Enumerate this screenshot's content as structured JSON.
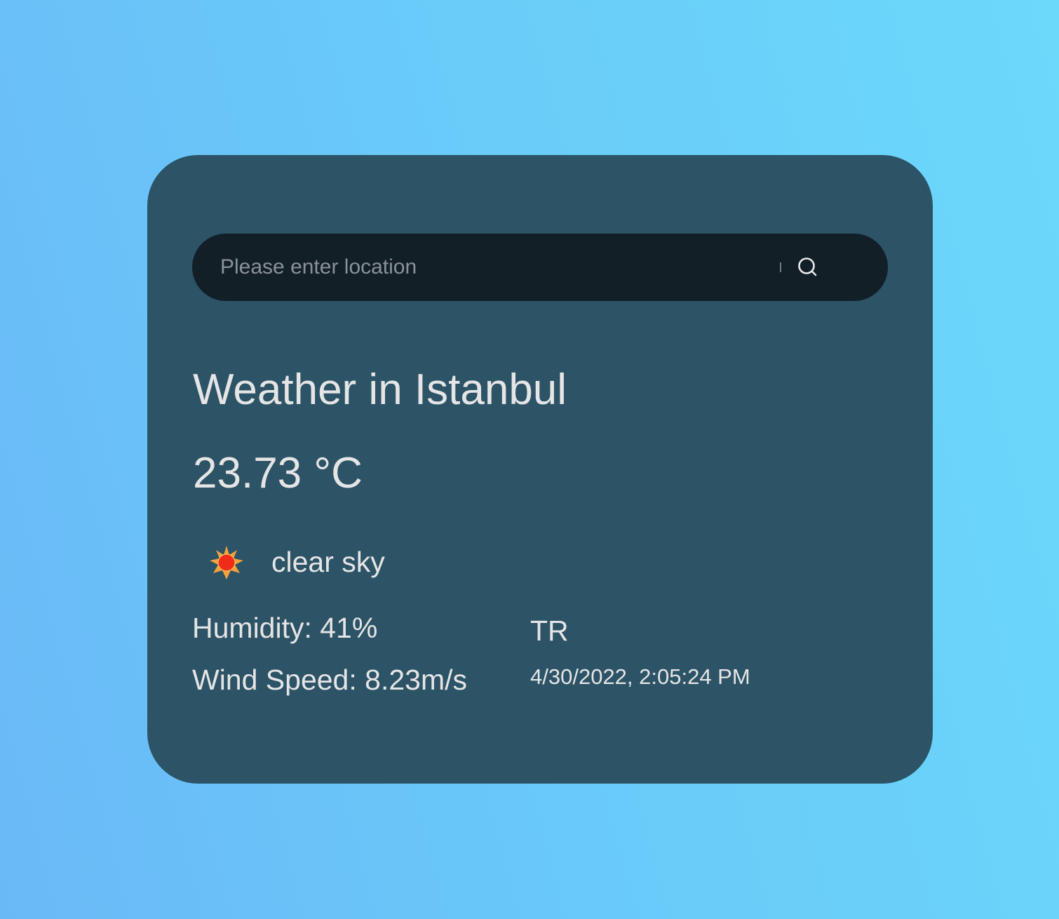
{
  "search": {
    "placeholder": "Please enter location",
    "value": ""
  },
  "weather": {
    "title": "Weather in Istanbul",
    "temperature": "23.73 °C",
    "icon": "sun-icon",
    "description": "clear sky",
    "humidity": "Humidity: 41%",
    "wind_speed": "Wind Speed: 8.23m/s",
    "country": "TR",
    "datetime": "4/30/2022, 2:05:24 PM"
  },
  "colors": {
    "background_gradient_start": "#6ab9f7",
    "background_gradient_end": "#6cd8fa",
    "card": "#2c5366",
    "search_bar": "#121f27",
    "text": "#e5e5e5",
    "sun_core": "#ef2b1a",
    "sun_rays": "#f3a23c"
  }
}
